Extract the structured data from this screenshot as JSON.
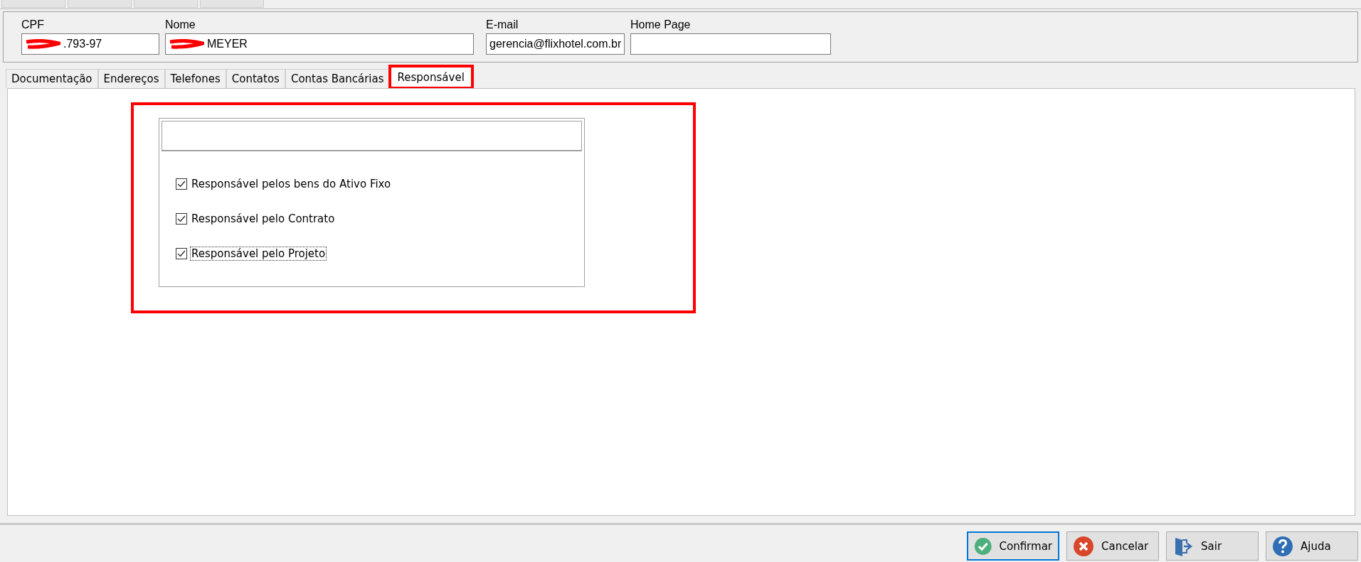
{
  "header": {
    "fields": [
      {
        "label": "CPF",
        "value": ".793-97",
        "redacted": true
      },
      {
        "label": "Nome",
        "value": "MEYER",
        "redacted": true
      },
      {
        "label": "E-mail",
        "value": "gerencia@flixhotel.com.br",
        "redacted": false
      },
      {
        "label": "Home Page",
        "redacted": false
      }
    ]
  },
  "tabs": [
    {
      "label": "Documentação",
      "selected": false,
      "highlighted": false
    },
    {
      "label": "Endereços",
      "selected": false,
      "highlighted": false
    },
    {
      "label": "Telefones",
      "selected": false,
      "highlighted": false
    },
    {
      "label": "Contatos",
      "selected": false,
      "highlighted": false
    },
    {
      "label": "Contas Bancárias",
      "selected": false,
      "highlighted": false
    },
    {
      "label": "Responsável",
      "selected": true,
      "highlighted": true
    }
  ],
  "options": [
    {
      "label": "Responsável pelos bens do Ativo Fixo",
      "checked": true,
      "focused": false
    },
    {
      "label": "Responsável pelo Contrato",
      "checked": true,
      "focused": false
    },
    {
      "label": "Responsável pelo Projeto",
      "checked": true,
      "focused": true
    }
  ],
  "buttons": [
    {
      "label": "Confirmar",
      "kind": "confirm",
      "default": true
    },
    {
      "label": "Cancelar",
      "kind": "cancel",
      "default": false
    },
    {
      "label": "Sair",
      "kind": "exit",
      "default": false
    },
    {
      "label": "Ajuda",
      "kind": "help",
      "default": false
    }
  ]
}
